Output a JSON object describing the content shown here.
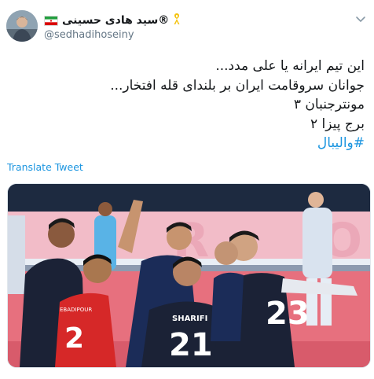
{
  "header": {
    "display_name": "سید هادی حسینی®",
    "handle": "@sedhadihoseiny",
    "ribbon_icon": "yellow-ribbon-icon",
    "flag_icon": "iran-flag-icon",
    "menu_icon": "chevron-down-icon"
  },
  "tweet": {
    "lines": [
      "این تیم ایرانه یا علی مدد...",
      "جوانان سروقامت ایران بر بلندای قله افتخار...",
      "مونترجنبان ۳",
      "برج پیزا ۲"
    ],
    "hashtag": "#والیبال",
    "translate_label": "Translate Tweet"
  },
  "photo": {
    "description_icon": "volleyball-team-photo",
    "jersey_numbers": [
      "2",
      "21",
      "23"
    ],
    "jersey_names": [
      "SHARIFI",
      "EBADIPOUR"
    ],
    "banner_letters": [
      "R",
      "O"
    ],
    "colors": {
      "court": "#e7707e",
      "banner": "#f2bcc8",
      "navy_jersey": "#1b2236",
      "red_jersey": "#d62828"
    }
  }
}
